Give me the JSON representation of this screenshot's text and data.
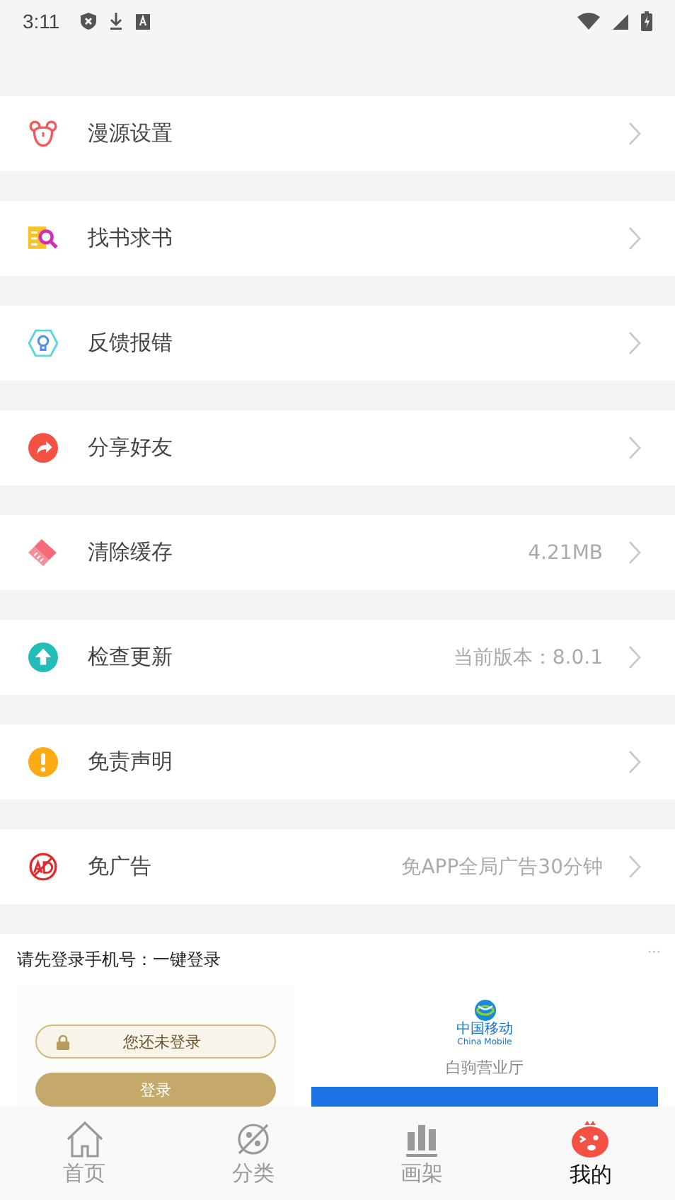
{
  "status_bar": {
    "time": "3:11"
  },
  "menu": [
    {
      "label": "漫源设置"
    },
    {
      "label": "找书求书"
    },
    {
      "label": "反馈报错"
    },
    {
      "label": "分享好友"
    },
    {
      "label": "清除缓存",
      "value": "4.21MB"
    },
    {
      "label": "检查更新",
      "value": "当前版本：8.0.1"
    },
    {
      "label": "免责声明"
    },
    {
      "label": "免广告",
      "value": "免APP全局广告30分钟"
    }
  ],
  "ad": {
    "title": "请先登录手机号：一键登录",
    "more": "···",
    "login_status": "您还未登录",
    "login_button": "登录",
    "brand": "中国移动",
    "brand_en": "China Mobile",
    "store": "白驹营业厅"
  },
  "tabs": [
    {
      "label": "首页",
      "selected": false
    },
    {
      "label": "分类",
      "selected": false
    },
    {
      "label": "画架",
      "selected": false
    },
    {
      "label": "我的",
      "selected": true
    }
  ]
}
